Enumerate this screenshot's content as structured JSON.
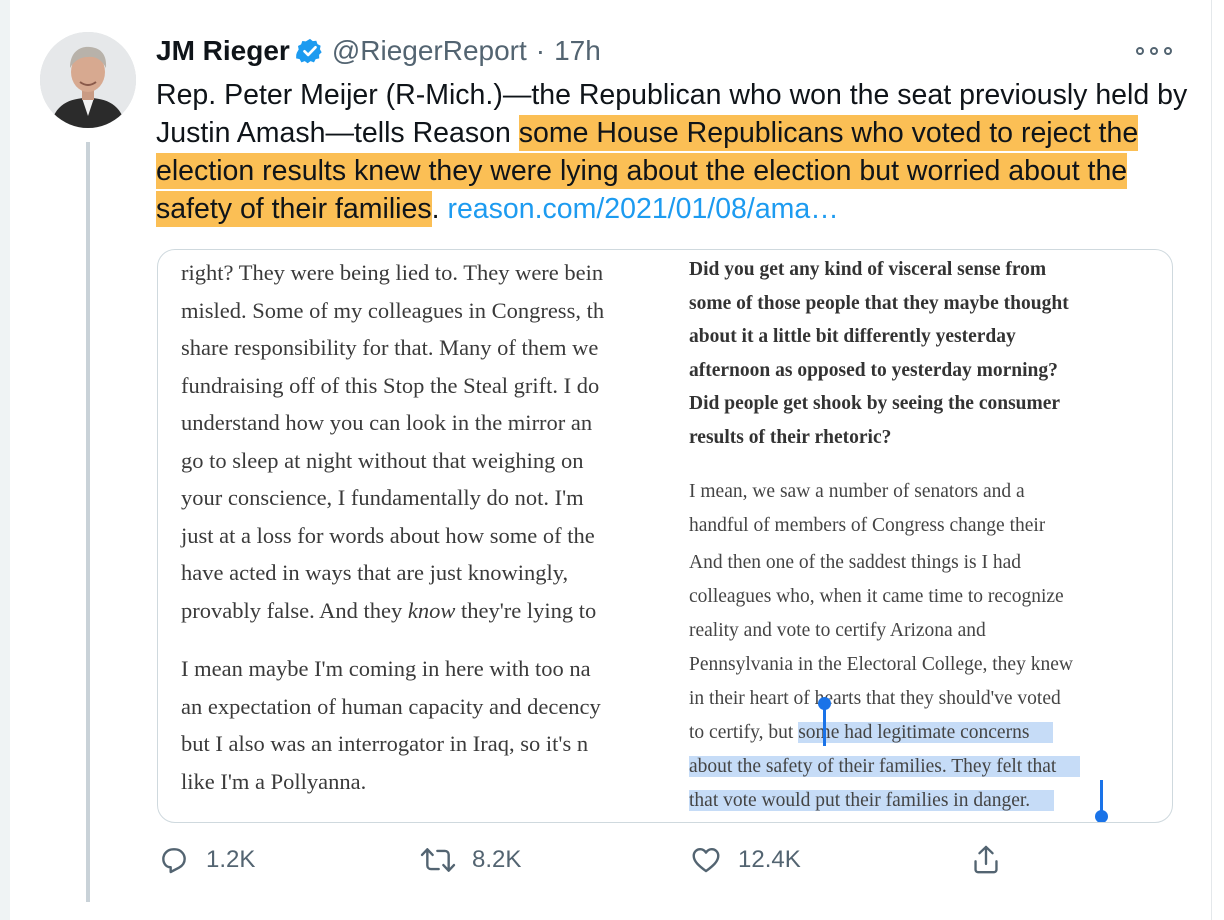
{
  "tweet": {
    "author_name": "JM Rieger",
    "handle": "@RiegerReport",
    "separator": "·",
    "time": "17h",
    "text_before": "Rep. Peter Meijer (R-Mich.)—the Republican who won the seat previously held by Justin Amash—tells Reason ",
    "text_highlight": "some House Republicans who voted to reject the election results knew they were lying about the election but worried about the safety of their families",
    "text_after": ". ",
    "link": "reason.com/2021/01/08/ama…"
  },
  "article": {
    "left_p1_lines": [
      "right? They were being lied to. They were bein",
      "misled. Some of my colleagues in Congress, th",
      "share responsibility for that. Many of them we",
      "fundraising off of this Stop the Steal grift. I do",
      "understand how you can look in the mirror an",
      "go to sleep at night without that weighing on",
      "your conscience, I fundamentally do not. I'm",
      "just at a loss for words about how some of the",
      "have acted in ways that are just knowingly,"
    ],
    "left_last_pre": "provably false. And they ",
    "left_last_em": "know",
    "left_last_post": " they're lying to",
    "left_p2_lines": [
      "I mean maybe I'm coming in here with too na",
      "an expectation of human capacity and decency",
      "but I also was an interrogator in Iraq, so it's n",
      "like I'm a Pollyanna."
    ],
    "right_question_lines": [
      "Did you get any kind of visceral sense from",
      "some of those people that they maybe thought",
      "about it a little bit differently yesterday",
      "afternoon as opposed to yesterday morning?",
      "Did people get shook by seeing the consumer",
      "results of their rhetoric?"
    ],
    "right_answer1_lines": [
      "I mean, we saw a number of senators and a",
      "handful of members of Congress change their"
    ],
    "right_answer2_lines": [
      "And then one of the saddest things is I had",
      "colleagues who, when it came time to recognize",
      "reality and vote to certify Arizona and",
      "Pennsylvania in the Electoral College, they knew",
      "in their heart of hearts that they should've voted"
    ],
    "right_sel_pre": "to certify, but ",
    "right_sel_part": "some had legitimate concerns",
    "right_sel_lines": [
      "about the safety of their families. They felt that",
      "that vote would put their families in danger."
    ]
  },
  "actions": {
    "reply_count": "1.2K",
    "retweet_count": "8.2K",
    "like_count": "12.4K"
  },
  "colors": {
    "highlight": "#fbbf55",
    "link": "#1d9bf0",
    "selection": "#c6dcf7",
    "verified": "#1d9bf0",
    "secondary_text": "#536471"
  },
  "icons": [
    "verified-badge-icon",
    "more-icon",
    "reply-icon",
    "retweet-icon",
    "like-icon",
    "share-icon"
  ]
}
